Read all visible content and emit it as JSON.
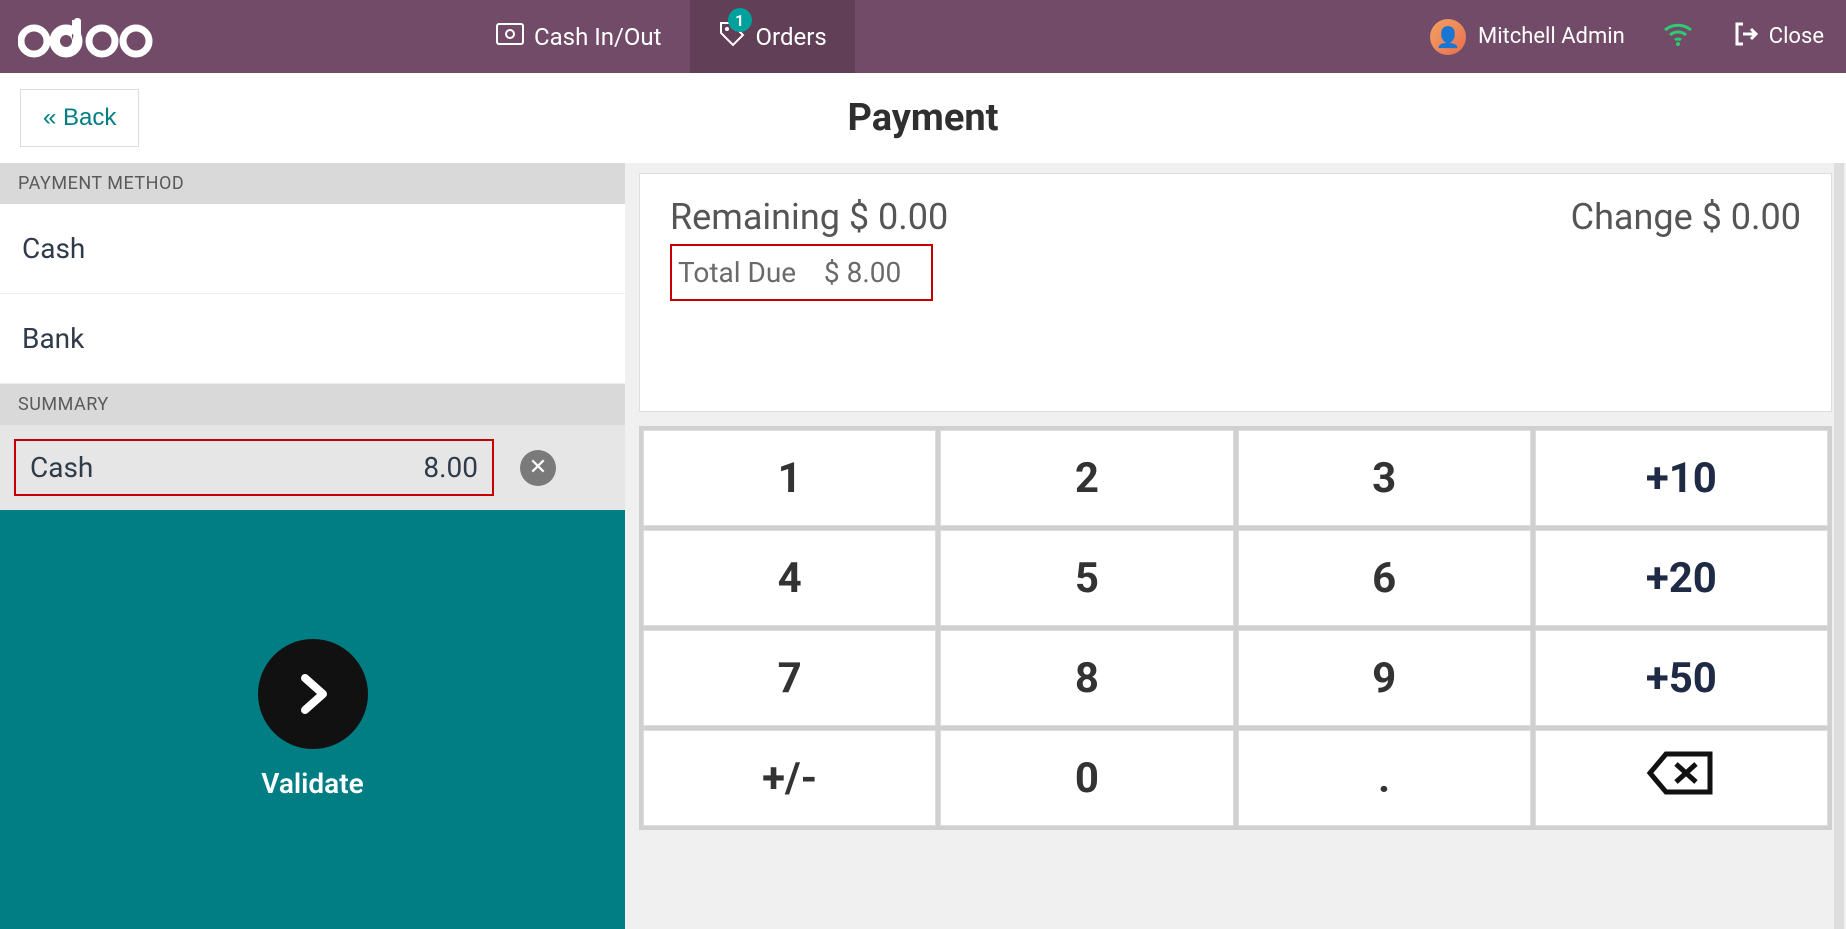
{
  "topbar": {
    "cash_in_out_label": "Cash In/Out",
    "orders_label": "Orders",
    "orders_badge": "1",
    "user_name": "Mitchell Admin",
    "close_label": "Close"
  },
  "header": {
    "back_label": "Back",
    "page_title": "Payment"
  },
  "left": {
    "payment_method_header": "PAYMENT METHOD",
    "methods": [
      {
        "label": "Cash"
      },
      {
        "label": "Bank"
      }
    ],
    "summary_header": "SUMMARY",
    "summary_line": {
      "method": "Cash",
      "amount": "8.00"
    },
    "validate_label": "Validate"
  },
  "right": {
    "remaining_label": "Remaining",
    "remaining_value": "$ 0.00",
    "change_label": "Change",
    "change_value": "$ 0.00",
    "total_due_label": "Total Due",
    "total_due_value": "$ 8.00",
    "keys": {
      "k1": "1",
      "k2": "2",
      "k3": "3",
      "p10": "+10",
      "k4": "4",
      "k5": "5",
      "k6": "6",
      "p20": "+20",
      "k7": "7",
      "k8": "8",
      "k9": "9",
      "p50": "+50",
      "pm": "+/-",
      "k0": "0",
      "dot": "."
    }
  }
}
